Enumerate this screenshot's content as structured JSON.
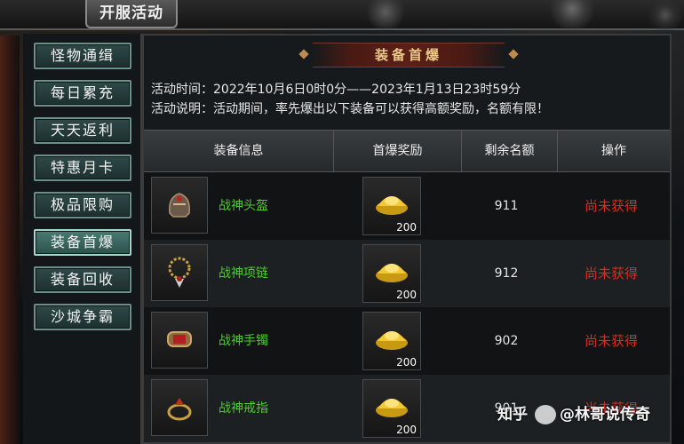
{
  "title_tab": "开服活动",
  "sidebar": {
    "items": [
      {
        "label": "怪物通缉",
        "active": false
      },
      {
        "label": "每日累充",
        "active": false
      },
      {
        "label": "天天返利",
        "active": false
      },
      {
        "label": "特惠月卡",
        "active": false
      },
      {
        "label": "极品限购",
        "active": false
      },
      {
        "label": "装备首爆",
        "active": true
      },
      {
        "label": "装备回收",
        "active": false
      },
      {
        "label": "沙城争霸",
        "active": false
      }
    ]
  },
  "panel": {
    "heading": "装备首爆",
    "time_line": "活动时间：2022年10月6日0时0分——2023年1月13日23时59分",
    "desc_line": "活动说明：活动期间，率先爆出以下装备可以获得高额奖励，名额有限！"
  },
  "table": {
    "headers": [
      "装备信息",
      "首爆奖励",
      "剩余名额",
      "操作"
    ],
    "rows": [
      {
        "icon": "helmet-icon",
        "name": "战神头盔",
        "reward": "200",
        "remaining": "911",
        "status": "尚未获得"
      },
      {
        "icon": "necklace-icon",
        "name": "战神项链",
        "reward": "200",
        "remaining": "912",
        "status": "尚未获得"
      },
      {
        "icon": "bracelet-icon",
        "name": "战神手镯",
        "reward": "200",
        "remaining": "902",
        "status": "尚未获得"
      },
      {
        "icon": "ring-icon",
        "name": "战神戒指",
        "reward": "200",
        "remaining": "901",
        "status": "尚未获得"
      }
    ]
  },
  "colors": {
    "item_name": "#4ccc2a",
    "status": "#e02a1e",
    "heading": "#e9c88a"
  },
  "watermark": {
    "site": "知乎",
    "author": "@林哥说传奇"
  }
}
